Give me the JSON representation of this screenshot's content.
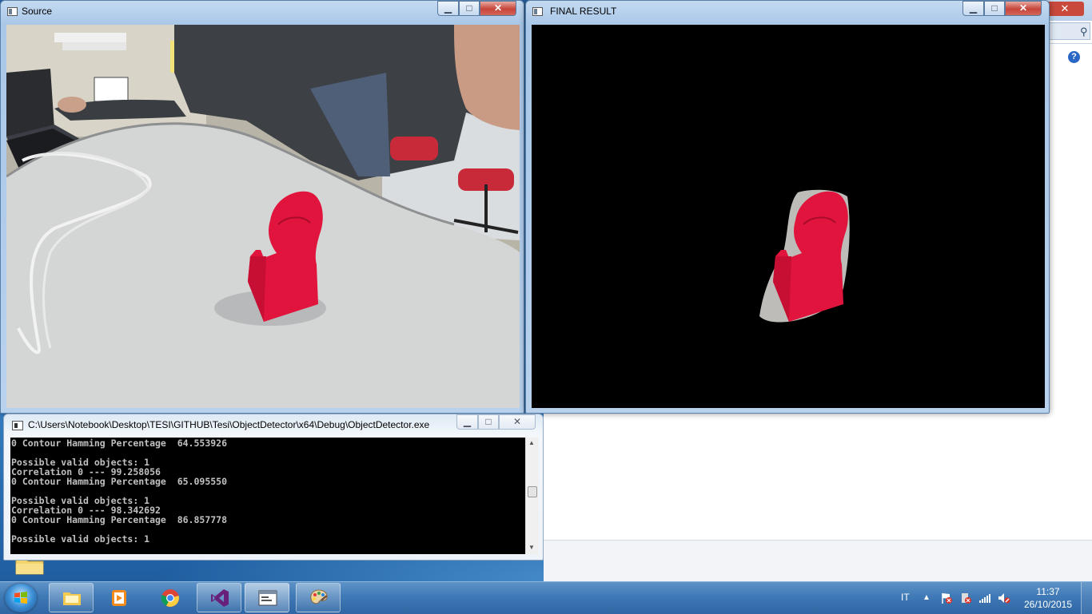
{
  "source_window": {
    "title": "Source",
    "min_label": "▁",
    "max_label": "□",
    "close_label": "✕"
  },
  "result_window": {
    "title": "FINAL RESULT",
    "min_label": "▁",
    "max_label": "□",
    "close_label": "✕"
  },
  "console_window": {
    "title": "C:\\Users\\Notebook\\Desktop\\TESI\\GITHUB\\Tesi\\ObjectDetector\\x64\\Debug\\ObjectDetector.exe",
    "min_label": "▁",
    "max_label": "□",
    "close_label": "✕",
    "lines": [
      "0 Contour Hamming Percentage  64.553926",
      "",
      "Possible valid objects: 1",
      "Correlation 0 --- 99.258056",
      "0 Contour Hamming Percentage  65.095550",
      "",
      "Possible valid objects: 1",
      "Correlation 0 --- 98.342692",
      "0 Contour Hamming Percentage  86.857778",
      "",
      "Possible valid objects: 1"
    ]
  },
  "background_app": {
    "search_icon": "magnifier-icon",
    "help_label": "?"
  },
  "taskbar": {
    "items": [
      {
        "name": "windows-explorer",
        "icon": "folder-icon"
      },
      {
        "name": "media-player",
        "icon": "media-player-icon"
      },
      {
        "name": "chrome",
        "icon": "chrome-icon"
      },
      {
        "name": "visual-studio",
        "icon": "visual-studio-icon"
      },
      {
        "name": "console-app",
        "icon": "console-window-icon"
      },
      {
        "name": "paint",
        "icon": "paint-palette-icon"
      }
    ],
    "language": "IT",
    "time": "11:37",
    "date": "26/10/2015"
  },
  "colors": {
    "object_red": "#e0143c",
    "console_text": "#c0c0c0",
    "window_frame": "#b8d2ee",
    "taskbar": "#3f79b6"
  }
}
